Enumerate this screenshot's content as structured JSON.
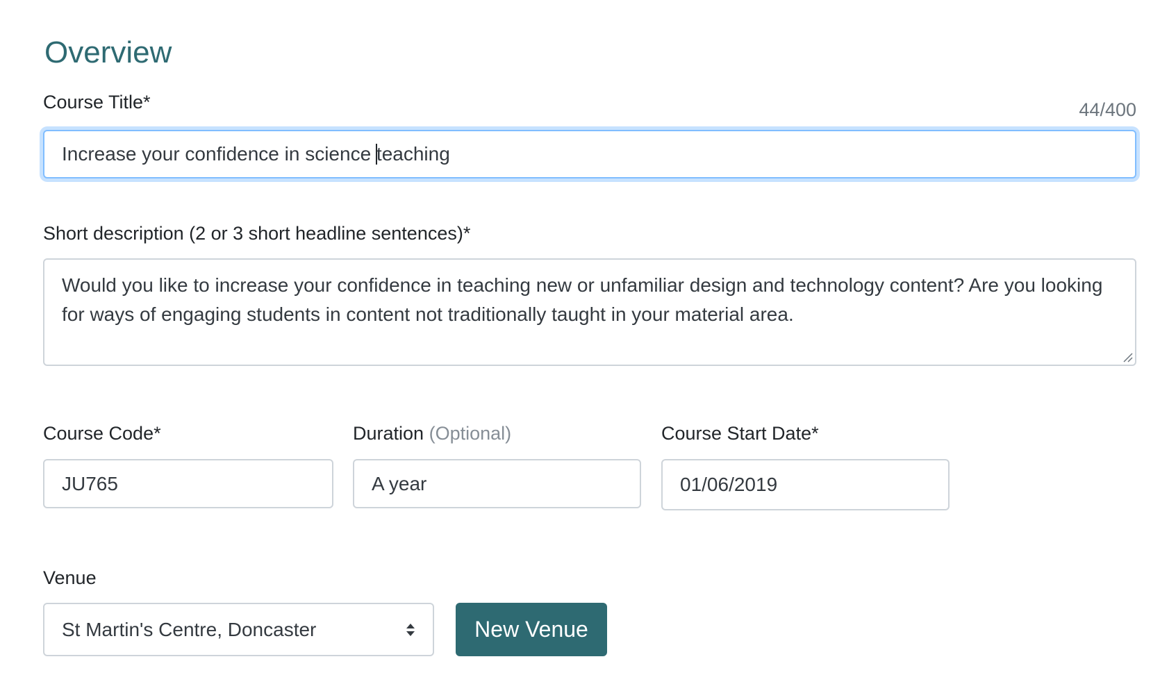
{
  "section": {
    "title": "Overview"
  },
  "course_title": {
    "label": "Course Title*",
    "counter": "44/400",
    "value_before_caret": "Increase your confidence in science ",
    "value_after_caret": "teaching"
  },
  "short_description": {
    "label": "Short description (2 or 3 short headline sentences)*",
    "value": "Would you like to increase your confidence in teaching new or unfamiliar design and technology content? Are you looking for ways of engaging students in content not traditionally taught in your material area."
  },
  "course_code": {
    "label": "Course Code*",
    "value": "JU765"
  },
  "duration": {
    "label": "Duration",
    "optional_label": "(Optional)",
    "value": "A year"
  },
  "start_date": {
    "label": "Course Start Date*",
    "value": "01/06/2019"
  },
  "venue": {
    "label": "Venue",
    "selected": "St Martin's Centre, Doncaster",
    "new_button_label": "New Venue"
  },
  "icons": {
    "select_arrows": "select-arrows-icon",
    "resize_handle": "resize-handle-icon"
  },
  "colors": {
    "accent": "#2e6a72",
    "focus_border": "#80bdff",
    "border": "#ced4da",
    "muted": "#868e96"
  }
}
